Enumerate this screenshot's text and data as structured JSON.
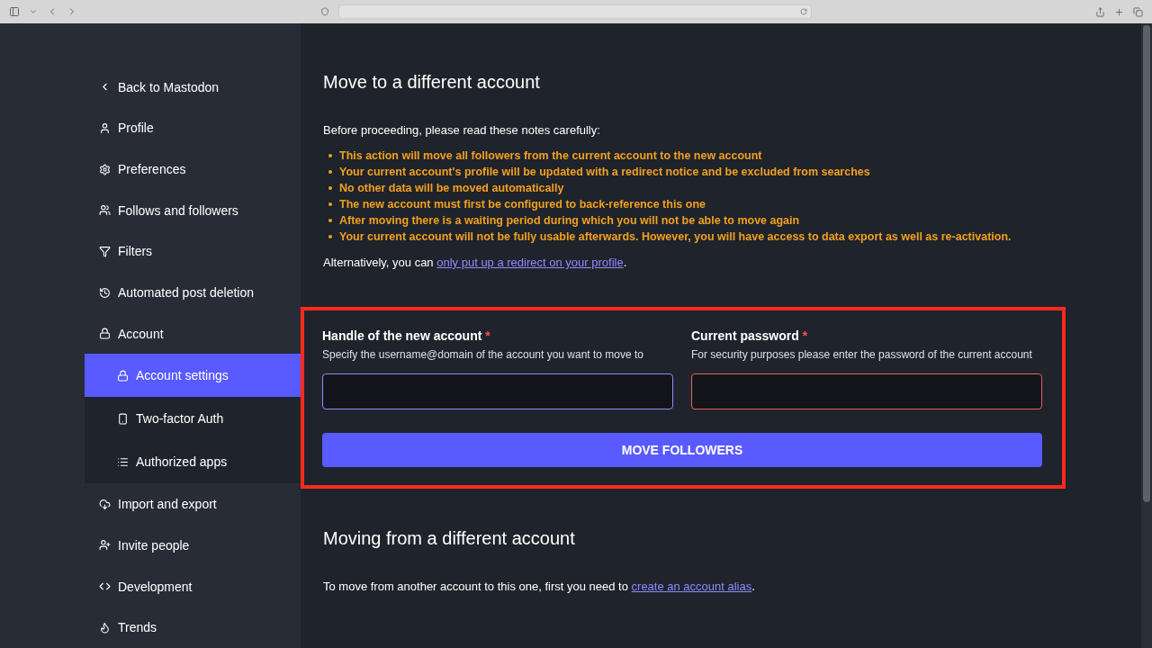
{
  "sidebar": {
    "items": [
      {
        "label": "Back to Mastodon",
        "selected": false
      },
      {
        "label": "Profile",
        "selected": false
      },
      {
        "label": "Preferences",
        "selected": false
      },
      {
        "label": "Follows and followers",
        "selected": false
      },
      {
        "label": "Filters",
        "selected": false
      },
      {
        "label": "Automated post deletion",
        "selected": false
      },
      {
        "label": "Account",
        "selected": false,
        "children": [
          {
            "label": "Account settings",
            "selected": true
          },
          {
            "label": "Two-factor Auth",
            "selected": false
          },
          {
            "label": "Authorized apps",
            "selected": false
          }
        ]
      },
      {
        "label": "Import and export",
        "selected": false
      },
      {
        "label": "Invite people",
        "selected": false
      },
      {
        "label": "Development",
        "selected": false
      },
      {
        "label": "Trends",
        "selected": false
      }
    ]
  },
  "main": {
    "title": "Move to a different account",
    "intro": "Before proceeding, please read these notes carefully:",
    "notes": [
      "This action will move all followers from the current account to the new account",
      "Your current account's profile will be updated with a redirect notice and be excluded from searches",
      "No other data will be moved automatically",
      "The new account must first be configured to back-reference this one",
      "After moving there is a waiting period during which you will not be able to move again",
      "Your current account will not be fully usable afterwards. However, you will have access to data export as well as re-activation."
    ],
    "alternative": {
      "text": "Alternatively, you can",
      "link": "only put up a redirect on your profile",
      "end": "."
    },
    "form": {
      "fields": [
        {
          "label": "Handle of the new account",
          "required": "*",
          "hint": "Specify the username@domain of the account you want to move to",
          "focused": true,
          "error": false
        },
        {
          "label": "Current password",
          "required": "*",
          "hint": "For security purposes please enter the password of the current account",
          "focused": false,
          "error": true
        }
      ],
      "button": "MOVE FOLLOWERS"
    },
    "section2": {
      "title": "Moving from a different account",
      "text": "To move from another account to this one, first you need to",
      "link": "create an account alias",
      "end": "."
    }
  }
}
